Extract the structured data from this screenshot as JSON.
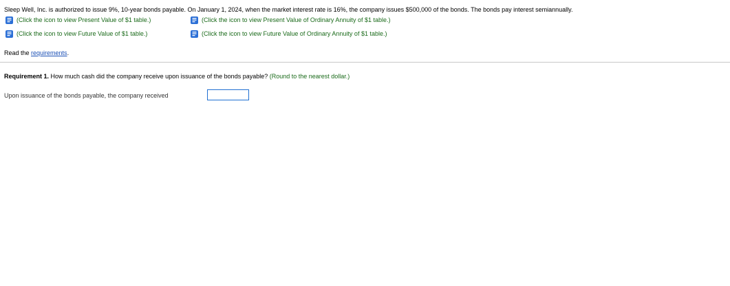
{
  "problem": {
    "statement": "Sleep Well, Inc. is authorized to issue 9%, 10-year bonds payable. On January 1, 2024, when the market interest rate is 16%, the company issues $500,000 of the bonds. The bonds pay interest semiannually."
  },
  "table_links": {
    "pv": "(Click the icon to view Present Value of $1 table.)",
    "pva": "(Click the icon to view Present Value of Ordinary Annuity of $1 table.)",
    "fv": "(Click the icon to view Future Value of $1 table.)",
    "fva": "(Click the icon to view Future Value of Ordinary Annuity of $1 table.)"
  },
  "read_line": {
    "prefix": "Read the ",
    "link_label": "requirements",
    "suffix": "."
  },
  "requirement": {
    "label": "Requirement 1.",
    "question": " How much cash did the company receive upon issuance of the bonds payable? ",
    "round_note": "(Round to the nearest dollar.)"
  },
  "answer": {
    "label": "Upon issuance of the bonds payable, the company received",
    "value": ""
  },
  "icons": {
    "table": "book-icon"
  },
  "colors": {
    "link_green": "#1a6a1a",
    "link_blue": "#1a4fb5",
    "icon_blue": "#2b6fd6",
    "input_border": "#1f6fd1"
  }
}
